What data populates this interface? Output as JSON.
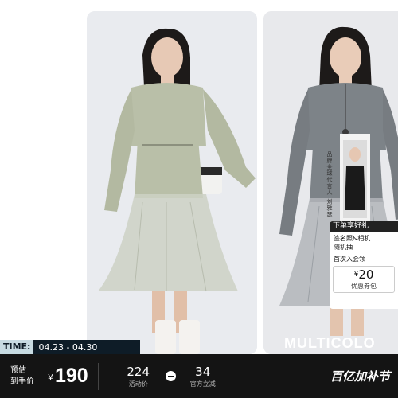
{
  "promo": {
    "header": "下单享好礼",
    "line1": "签名照&相机",
    "line2": "随机抽",
    "line3": "首次入会领",
    "coupon_symbol": "¥",
    "coupon_amount": "20",
    "coupon_label": "优惠券包"
  },
  "endorser_text": "品牌全球代言人 刘雅瑟",
  "time_tag": {
    "label": "TIME:",
    "value": "04.23 - 04.30"
  },
  "brand_text": "MULTICOLO",
  "bottom_bar": {
    "presale_line1": "预估",
    "presale_line2": "到手价",
    "currency": "¥",
    "price": "190",
    "stat1_value": "224",
    "stat1_label": "活动价",
    "stat2_value": "34",
    "stat2_label": "官方立减",
    "festival": "百亿加补节"
  },
  "colors": {
    "bar_bg": "#141414",
    "sweater_a": "#b9bfa8",
    "sweater_b": "#7d8388",
    "time_label_bg": "#c7dbe2"
  }
}
